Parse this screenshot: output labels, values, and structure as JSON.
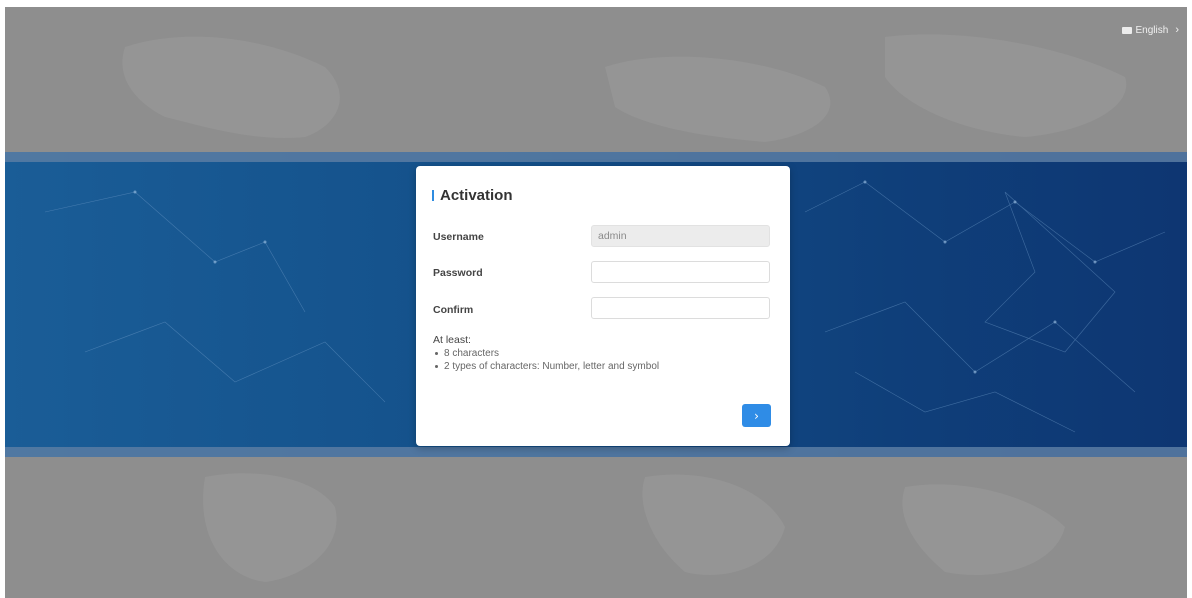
{
  "language": {
    "label": "English",
    "icon": "keyboard-icon",
    "chevron_icon": "chevron-right-icon"
  },
  "activation": {
    "title": "Activation",
    "username": {
      "label": "Username",
      "value": "admin",
      "readonly": true
    },
    "password": {
      "label": "Password",
      "value": "",
      "placeholder": ""
    },
    "confirm": {
      "label": "Confirm",
      "value": "",
      "placeholder": ""
    },
    "requirements": {
      "heading": "At least:",
      "items": [
        "8 characters",
        "2 types of characters: Number, letter and symbol"
      ]
    },
    "next_button": {
      "glyph": "›",
      "icon": "chevron-right-icon"
    }
  },
  "colors": {
    "accent": "#2f8ce6",
    "band": "#134f89",
    "backdrop": "#8e8e8e",
    "modal_bg": "#ffffff"
  }
}
